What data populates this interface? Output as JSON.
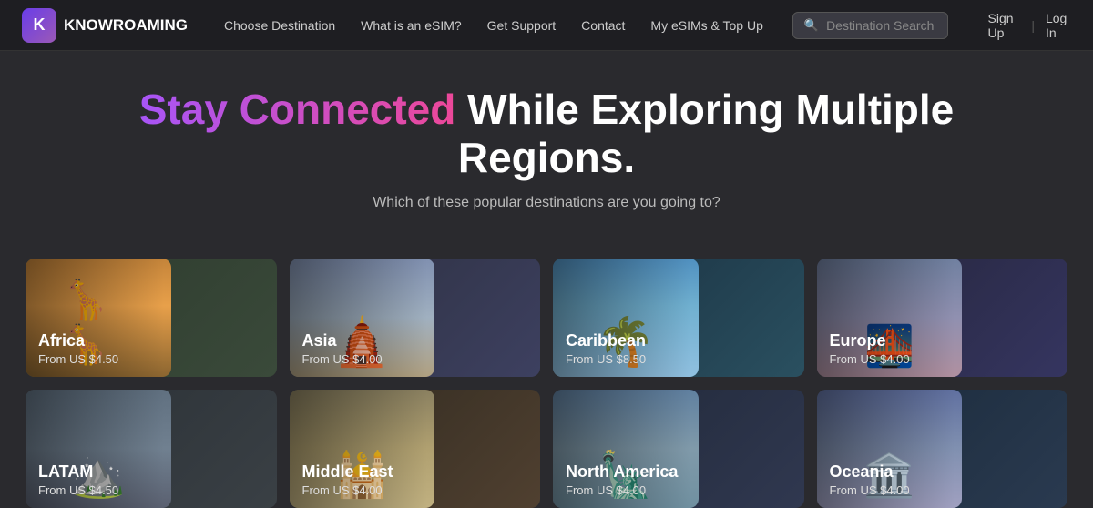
{
  "nav": {
    "logo_letter": "K",
    "logo_name": "KNOWROAMING",
    "links": [
      {
        "label": "Choose Destination"
      },
      {
        "label": "What is an eSIM?"
      },
      {
        "label": "Get Support"
      },
      {
        "label": "Contact"
      },
      {
        "label": "My eSIMs & Top Up"
      }
    ],
    "search_placeholder": "Destination Search",
    "sign_up": "Sign Up",
    "divider": "|",
    "log_in": "Log In"
  },
  "hero": {
    "title_colored": "Stay Connected",
    "title_rest": " While Exploring Multiple Regions.",
    "subtitle": "Which of these popular destinations are you going to?"
  },
  "destinations_row1": [
    {
      "id": "africa",
      "name": "Africa",
      "price": "From US $4.50",
      "img_class": "img-africa",
      "card_class": "card-africa"
    },
    {
      "id": "asia",
      "name": "Asia",
      "price": "From US $4.00",
      "img_class": "img-asia",
      "card_class": "card-asia"
    },
    {
      "id": "caribbean",
      "name": "Caribbean",
      "price": "From US $8.50",
      "img_class": "img-caribbean",
      "card_class": "card-caribbean"
    },
    {
      "id": "europe",
      "name": "Europe",
      "price": "From US $4.00",
      "img_class": "img-europe",
      "card_class": "card-europe"
    }
  ],
  "destinations_row2": [
    {
      "id": "latam",
      "name": "LATAM",
      "price": "From US $4.50",
      "img_class": "img-latam",
      "card_class": "card-latam"
    },
    {
      "id": "middleeast",
      "name": "Middle East",
      "price": "From US $4.00",
      "img_class": "img-middleeast",
      "card_class": "card-middleeast"
    },
    {
      "id": "northamerica",
      "name": "North America",
      "price": "From US $4.00",
      "img_class": "img-northamerica",
      "card_class": "card-northamerica"
    },
    {
      "id": "oceania",
      "name": "Oceania",
      "price": "From US $4.00",
      "img_class": "img-oceania",
      "card_class": "card-oceania"
    }
  ]
}
